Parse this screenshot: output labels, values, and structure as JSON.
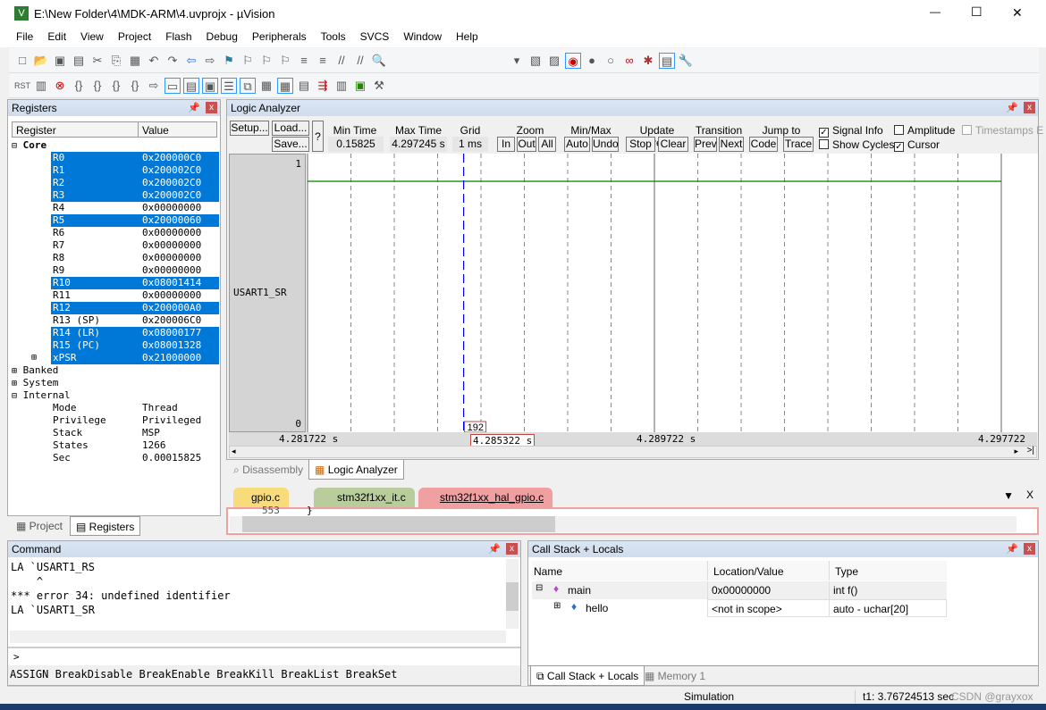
{
  "window": {
    "title": "E:\\New Folder\\4\\MDK-ARM\\4.uvprojx - µVision",
    "minimize": "—",
    "maximize": "☐",
    "close": "✕"
  },
  "menu": [
    "File",
    "Edit",
    "View",
    "Project",
    "Flash",
    "Debug",
    "Peripherals",
    "Tools",
    "SVCS",
    "Window",
    "Help"
  ],
  "registers": {
    "title": "Registers",
    "col_register": "Register",
    "col_value": "Value",
    "core": "Core",
    "rows": [
      {
        "name": "R0",
        "value": "0x200000C0",
        "selected": true
      },
      {
        "name": "R1",
        "value": "0x200002C0",
        "selected": true
      },
      {
        "name": "R2",
        "value": "0x200002C0",
        "selected": true
      },
      {
        "name": "R3",
        "value": "0x200002C0",
        "selected": true
      },
      {
        "name": "R4",
        "value": "0x00000000",
        "selected": false
      },
      {
        "name": "R5",
        "value": "0x20000060",
        "selected": true
      },
      {
        "name": "R6",
        "value": "0x00000000",
        "selected": false
      },
      {
        "name": "R7",
        "value": "0x00000000",
        "selected": false
      },
      {
        "name": "R8",
        "value": "0x00000000",
        "selected": false
      },
      {
        "name": "R9",
        "value": "0x00000000",
        "selected": false
      },
      {
        "name": "R10",
        "value": "0x08001414",
        "selected": true
      },
      {
        "name": "R11",
        "value": "0x00000000",
        "selected": false
      },
      {
        "name": "R12",
        "value": "0x200000A0",
        "selected": true
      },
      {
        "name": "R13 (SP)",
        "value": "0x200006C0",
        "selected": false
      },
      {
        "name": "R14 (LR)",
        "value": "0x08000177",
        "selected": true
      },
      {
        "name": "R15 (PC)",
        "value": "0x08001328",
        "selected": true
      },
      {
        "name": "xPSR",
        "value": "0x21000000",
        "selected": true
      }
    ],
    "groups": [
      "Banked",
      "System",
      "Internal"
    ],
    "internal": [
      {
        "name": "Mode",
        "value": "Thread"
      },
      {
        "name": "Privilege",
        "value": "Privileged"
      },
      {
        "name": "Stack",
        "value": "MSP"
      },
      {
        "name": "States",
        "value": "1266"
      },
      {
        "name": "Sec",
        "value": "0.00015825"
      }
    ],
    "tab_project": "Project",
    "tab_registers": "Registers"
  },
  "la": {
    "title": "Logic Analyzer",
    "setup": "Setup...",
    "load": "Load...",
    "save": "Save...",
    "help": "?",
    "min_time_label": "Min Time",
    "min_time": "0.15825 ms",
    "max_time_label": "Max Time",
    "max_time": "4.297245 s",
    "grid_label": "Grid",
    "grid": "1 ms",
    "zoom_label": "Zoom",
    "zoom_in": "In",
    "zoom_out": "Out",
    "zoom_all": "All",
    "minmax_label": "Min/Max",
    "auto": "Auto",
    "undo": "Undo",
    "update_label": "Update Screen",
    "stop": "Stop",
    "clear": "Clear",
    "transition_label": "Transition",
    "prev": "Prev",
    "next": "Next",
    "jump_label": "Jump to",
    "code": "Code",
    "trace": "Trace",
    "signal_info": "Signal Info",
    "signal_info_checked": true,
    "show_cycles": "Show Cycles",
    "show_cycles_checked": false,
    "amplitude": "Amplitude",
    "amplitude_checked": false,
    "cursor": "Cursor",
    "cursor_checked": true,
    "timestamps": "Timestamps E",
    "signal": "USART1_SR",
    "y_max": "1",
    "y_min": "0",
    "cursor_value": "192",
    "signal_level": 1,
    "time_start": "4.281722 s",
    "time_mid": "4.289722 s",
    "time_end": "4.297722 s",
    "cursor_time": "4.285322 s",
    "t_start": 4.281722,
    "t_end": 4.297722,
    "t_cursor": 4.285322,
    "signal_color": "#008000",
    "cursor_color": "#0000ff"
  },
  "view_tabs": {
    "disassembly": "Disassembly",
    "logic_analyzer": "Logic Analyzer"
  },
  "editor": {
    "tabs": [
      "gpio.c",
      "stm32f1xx_it.c",
      "stm32f1xx_hal_gpio.c"
    ],
    "line_no": "553",
    "line_text": "}"
  },
  "command": {
    "title": "Command",
    "lines": [
      "LA `USART1_RS",
      "    ^",
      "*** error 34: undefined identifier",
      "LA `USART1_SR"
    ],
    "prompt": ">",
    "hints": "ASSIGN BreakDisable BreakEnable BreakKill BreakList BreakSet"
  },
  "callstack": {
    "title": "Call Stack + Locals",
    "cols": [
      "Name",
      "Location/Value",
      "Type"
    ],
    "rows": [
      {
        "name": "main",
        "value": "0x00000000",
        "type": "int f()"
      },
      {
        "name": "hello",
        "value": "<not in scope>",
        "type": "auto - uchar[20]"
      }
    ],
    "tab_callstack": "Call Stack + Locals",
    "tab_memory": "Memory 1"
  },
  "status": {
    "mode": "Simulation",
    "time": "t1: 3.76724513 sec",
    "watermark": "CSDN @grayxox"
  }
}
